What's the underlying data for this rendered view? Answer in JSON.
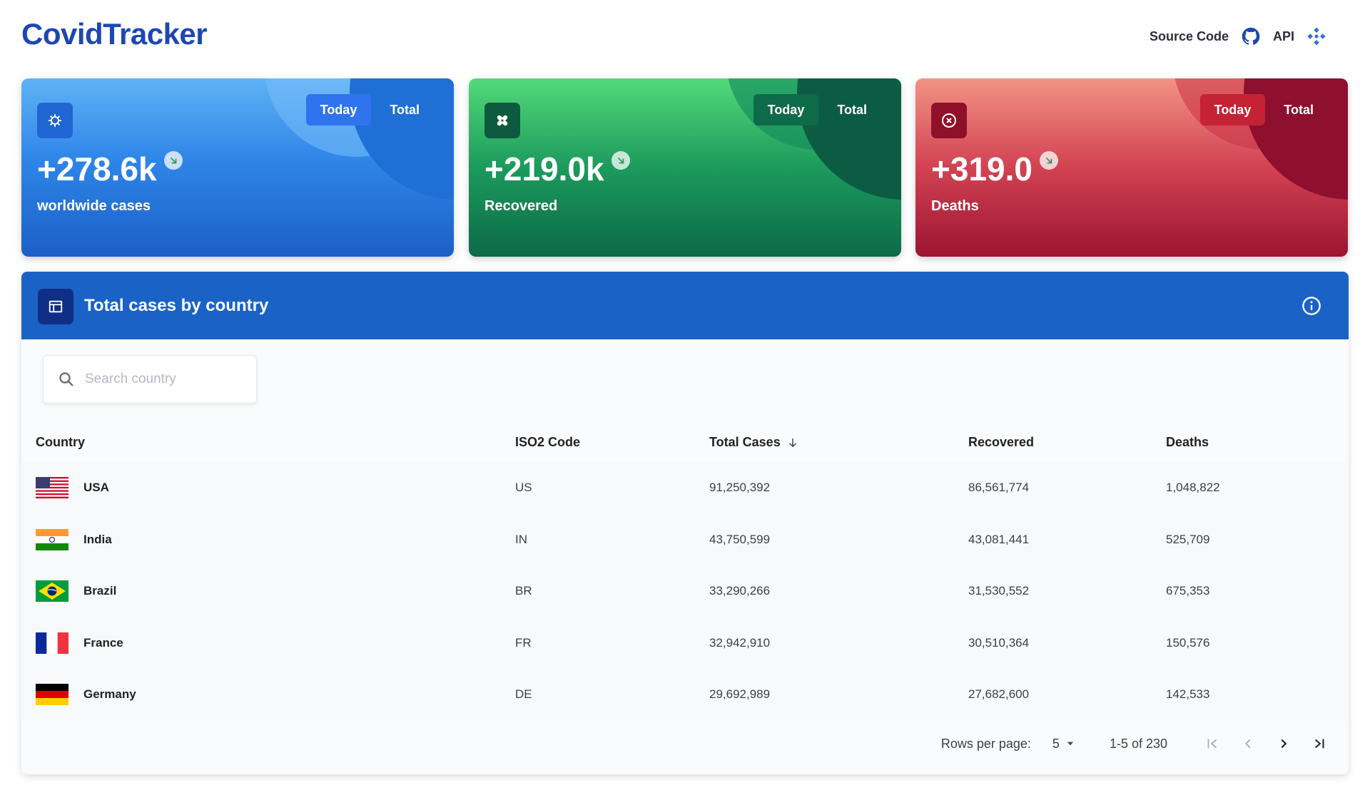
{
  "header": {
    "brand": "CovidTracker",
    "source_code_label": "Source Code",
    "api_label": "API"
  },
  "stats": [
    {
      "value": "+278.6k",
      "caption": "worldwide cases",
      "today_label": "Today",
      "total_label": "Total",
      "icon": "virus-icon",
      "accent": "#2f86e8"
    },
    {
      "value": "+219.0k",
      "caption": "Recovered",
      "today_label": "Today",
      "total_label": "Total",
      "icon": "bandage-icon",
      "accent": "#1c9a5c"
    },
    {
      "value": "+319.0",
      "caption": "Deaths",
      "today_label": "Today",
      "total_label": "Total",
      "icon": "cancel-circle-icon",
      "accent": "#d24252"
    }
  ],
  "panel": {
    "title": "Total cases by country",
    "search_placeholder": "Search country",
    "columns": [
      "Country",
      "ISO2 Code",
      "Total Cases",
      "Recovered",
      "Deaths"
    ],
    "rows": [
      {
        "country": "USA",
        "iso": "US",
        "total": "91,250,392",
        "recovered": "86,561,774",
        "deaths": "1,048,822"
      },
      {
        "country": "India",
        "iso": "IN",
        "total": "43,750,599",
        "recovered": "43,081,441",
        "deaths": "525,709"
      },
      {
        "country": "Brazil",
        "iso": "BR",
        "total": "33,290,266",
        "recovered": "31,530,552",
        "deaths": "675,353"
      },
      {
        "country": "France",
        "iso": "FR",
        "total": "32,942,910",
        "recovered": "30,510,364",
        "deaths": "150,576"
      },
      {
        "country": "Germany",
        "iso": "DE",
        "total": "29,692,989",
        "recovered": "27,682,600",
        "deaths": "142,533"
      }
    ],
    "pagination": {
      "rows_per_page_label": "Rows per page:",
      "rows_per_page": "5",
      "range": "1-5 of 230"
    }
  }
}
